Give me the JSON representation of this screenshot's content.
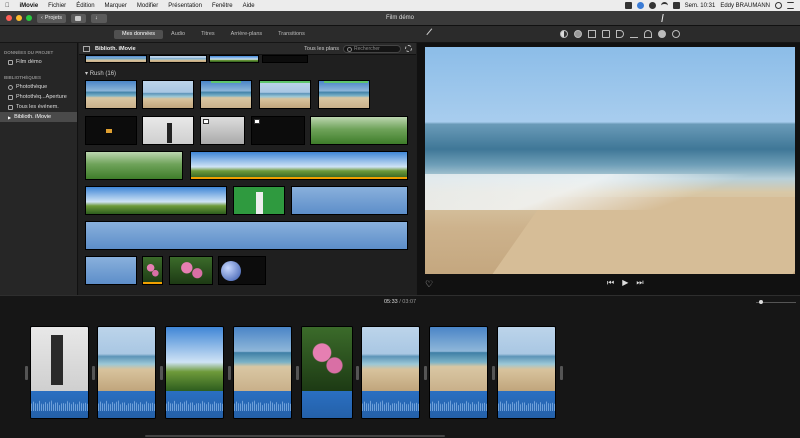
{
  "menubar": {
    "apple": "",
    "app": "iMovie",
    "items": [
      "Fichier",
      "Édition",
      "Marquer",
      "Modifier",
      "Présentation",
      "Fenêtre",
      "Aide"
    ],
    "clock": "Sem. 10:31",
    "user": "Eddy BRAUMANN"
  },
  "titlebar": {
    "back": "Projets",
    "title": "Film démo",
    "traffic_colors": [
      "#ff5f57",
      "#febc2e",
      "#28c840"
    ]
  },
  "toolbar": {
    "tabs": [
      "Mes données",
      "Audio",
      "Titres",
      "Arrière-plans",
      "Transitions"
    ],
    "active_tab": 0,
    "tool_icons": [
      "color-balance-icon",
      "color-correction-icon",
      "crop-icon",
      "stabilization-icon",
      "volume-icon",
      "noise-reduction-icon",
      "speed-icon",
      "filter-icon",
      "info-icon"
    ]
  },
  "sidebar": {
    "sections": [
      {
        "heading": "DONNÉES DU PROJET",
        "items": [
          {
            "label": "Film démo",
            "icon": "film-icon"
          }
        ]
      },
      {
        "heading": "BIBLIOTHÈQUES",
        "items": [
          {
            "label": "Photothèque",
            "icon": "photos-icon"
          },
          {
            "label": "Photothèq...Aperture",
            "icon": "aperture-icon"
          },
          {
            "label": "Tous les événem.",
            "icon": "events-icon"
          },
          {
            "label": "Biblioth. iMovie",
            "icon": "library-icon",
            "selected": true
          }
        ]
      }
    ]
  },
  "browser": {
    "library": "Biblioth. iMovie",
    "filter": "Tous les plans",
    "search_placeholder": "Rechercher",
    "event": "Rush",
    "event_count": "(16)"
  },
  "timeline": {
    "current": "05:33",
    "separator": "/",
    "total": "03:07"
  }
}
